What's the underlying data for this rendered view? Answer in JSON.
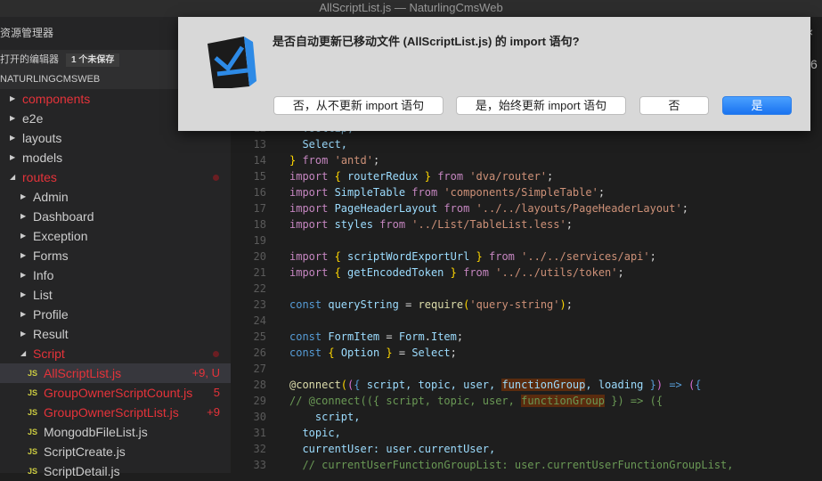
{
  "window": {
    "title": "AllScriptList.js — NaturlingCmsWeb"
  },
  "sidebar": {
    "title": "资源管理器",
    "open_editors": {
      "label": "打开的编辑器",
      "badge": "1 个未保存"
    },
    "project": "NATURLINGCMSWEB",
    "tree": [
      {
        "label": "components",
        "depth": 0,
        "type": "folder",
        "expanded": false,
        "modified": true
      },
      {
        "label": "e2e",
        "depth": 0,
        "type": "folder",
        "expanded": false
      },
      {
        "label": "layouts",
        "depth": 0,
        "type": "folder",
        "expanded": false
      },
      {
        "label": "models",
        "depth": 0,
        "type": "folder",
        "expanded": false
      },
      {
        "label": "routes",
        "depth": 0,
        "type": "folder",
        "expanded": true,
        "modified": true,
        "dot": true
      },
      {
        "label": "Admin",
        "depth": 1,
        "type": "folder",
        "expanded": false
      },
      {
        "label": "Dashboard",
        "depth": 1,
        "type": "folder",
        "expanded": false
      },
      {
        "label": "Exception",
        "depth": 1,
        "type": "folder",
        "expanded": false
      },
      {
        "label": "Forms",
        "depth": 1,
        "type": "folder",
        "expanded": false
      },
      {
        "label": "Info",
        "depth": 1,
        "type": "folder",
        "expanded": false
      },
      {
        "label": "List",
        "depth": 1,
        "type": "folder",
        "expanded": false
      },
      {
        "label": "Profile",
        "depth": 1,
        "type": "folder",
        "expanded": false
      },
      {
        "label": "Result",
        "depth": 1,
        "type": "folder",
        "expanded": false
      },
      {
        "label": "Script",
        "depth": 1,
        "type": "folder",
        "expanded": true,
        "modified": true,
        "dot": true
      },
      {
        "label": "AllScriptList.js",
        "depth": 2,
        "type": "js",
        "modified": true,
        "selected": true,
        "decoration": "+9, U"
      },
      {
        "label": "GroupOwnerScriptCount.js",
        "depth": 2,
        "type": "js",
        "modified": true,
        "decoration": "5"
      },
      {
        "label": "GroupOwnerScriptList.js",
        "depth": 2,
        "type": "js",
        "modified": true,
        "decoration": "+9"
      },
      {
        "label": "MongodbFileList.js",
        "depth": 2,
        "type": "js"
      },
      {
        "label": "ScriptCreate.js",
        "depth": 2,
        "type": "js"
      },
      {
        "label": "ScriptDetail.js",
        "depth": 2,
        "type": "js"
      }
    ],
    "js_icon": "JS"
  },
  "editor": {
    "lines": [
      {
        "n": "12",
        "t": [
          [
            "  Tooltip,",
            "v"
          ]
        ]
      },
      {
        "n": "13",
        "t": [
          [
            "  Select,",
            "v"
          ]
        ]
      },
      {
        "n": "14",
        "t": [
          [
            "}",
            "b"
          ],
          [
            " from ",
            "kw"
          ],
          [
            "'antd'",
            "s"
          ],
          [
            ";",
            "p"
          ]
        ]
      },
      {
        "n": "15",
        "t": [
          [
            "import ",
            "kw"
          ],
          [
            "{",
            "b"
          ],
          [
            " routerRedux ",
            "v"
          ],
          [
            "}",
            "b"
          ],
          [
            " from ",
            "kw"
          ],
          [
            "'dva/router'",
            "s"
          ],
          [
            ";",
            "p"
          ]
        ]
      },
      {
        "n": "16",
        "t": [
          [
            "import ",
            "kw"
          ],
          [
            "SimpleTable",
            "v"
          ],
          [
            " from ",
            "kw"
          ],
          [
            "'components/SimpleTable'",
            "s"
          ],
          [
            ";",
            "p"
          ]
        ]
      },
      {
        "n": "17",
        "t": [
          [
            "import ",
            "kw"
          ],
          [
            "PageHeaderLayout",
            "v"
          ],
          [
            " from ",
            "kw"
          ],
          [
            "'../../layouts/PageHeaderLayout'",
            "s"
          ],
          [
            ";",
            "p"
          ]
        ]
      },
      {
        "n": "18",
        "t": [
          [
            "import ",
            "kw"
          ],
          [
            "styles",
            "v"
          ],
          [
            " from ",
            "kw"
          ],
          [
            "'../List/TableList.less'",
            "s"
          ],
          [
            ";",
            "p"
          ]
        ]
      },
      {
        "n": "19",
        "t": []
      },
      {
        "n": "20",
        "t": [
          [
            "import ",
            "kw"
          ],
          [
            "{",
            "b"
          ],
          [
            " scriptWordExportUrl ",
            "v"
          ],
          [
            "}",
            "b"
          ],
          [
            " from ",
            "kw"
          ],
          [
            "'../../services/api'",
            "s"
          ],
          [
            ";",
            "p"
          ]
        ]
      },
      {
        "n": "21",
        "t": [
          [
            "import ",
            "kw"
          ],
          [
            "{",
            "b"
          ],
          [
            " getEncodedToken ",
            "v"
          ],
          [
            "}",
            "b"
          ],
          [
            " from ",
            "kw"
          ],
          [
            "'../../utils/token'",
            "s"
          ],
          [
            ";",
            "p"
          ]
        ]
      },
      {
        "n": "22",
        "t": []
      },
      {
        "n": "23",
        "t": [
          [
            "const ",
            "st"
          ],
          [
            "queryString",
            "v"
          ],
          [
            " = ",
            "p"
          ],
          [
            "require",
            "f"
          ],
          [
            "(",
            "b"
          ],
          [
            "'query-string'",
            "s"
          ],
          [
            ")",
            "b"
          ],
          [
            ";",
            "p"
          ]
        ]
      },
      {
        "n": "24",
        "t": []
      },
      {
        "n": "25",
        "t": [
          [
            "const ",
            "st"
          ],
          [
            "FormItem",
            "v"
          ],
          [
            " = ",
            "p"
          ],
          [
            "Form",
            "v"
          ],
          [
            ".",
            "p"
          ],
          [
            "Item",
            "v"
          ],
          [
            ";",
            "p"
          ]
        ]
      },
      {
        "n": "26",
        "t": [
          [
            "const ",
            "st"
          ],
          [
            "{",
            "b"
          ],
          [
            " Option ",
            "v"
          ],
          [
            "}",
            "b"
          ],
          [
            " = ",
            "p"
          ],
          [
            "Select",
            "v"
          ],
          [
            ";",
            "p"
          ]
        ]
      },
      {
        "n": "27",
        "t": []
      },
      {
        "n": "28",
        "t": [
          [
            "@connect",
            "f"
          ],
          [
            "(",
            "b"
          ],
          [
            "(",
            "bp"
          ],
          [
            "{",
            "ar"
          ],
          [
            " script, topic, user, ",
            "v"
          ],
          [
            "functionGroup",
            "v hl"
          ],
          [
            ", loading ",
            "v"
          ],
          [
            "}",
            "ar"
          ],
          [
            ")",
            "bp"
          ],
          [
            " => ",
            "ar"
          ],
          [
            "(",
            "bp"
          ],
          [
            "{",
            "ar"
          ]
        ]
      },
      {
        "n": "29",
        "t": [
          [
            "// @connect(({ script, topic, user, ",
            "c"
          ],
          [
            "functionGroup",
            "c hl"
          ],
          [
            " }) => ({",
            "c"
          ]
        ]
      },
      {
        "n": "30",
        "t": [
          [
            "    script,",
            "v"
          ]
        ]
      },
      {
        "n": "31",
        "t": [
          [
            "  topic,",
            "v"
          ]
        ]
      },
      {
        "n": "32",
        "t": [
          [
            "  currentUser: user.currentUser,",
            "v"
          ]
        ]
      },
      {
        "n": "33",
        "t": [
          [
            "  // currentUserFunctionGroupList: user.currentUserFunctionGroupList,",
            "c"
          ]
        ]
      }
    ]
  },
  "dialog": {
    "message": "是否自动更新已移动文件 (AllScriptList.js) 的 import 语句?",
    "buttons": {
      "never": "否，从不更新 import 语句",
      "always": "是，始终更新 import 语句",
      "no": "否",
      "yes": "是"
    },
    "accent": "#1a73f0"
  },
  "behind": {
    "close": "×",
    "count": "6"
  }
}
